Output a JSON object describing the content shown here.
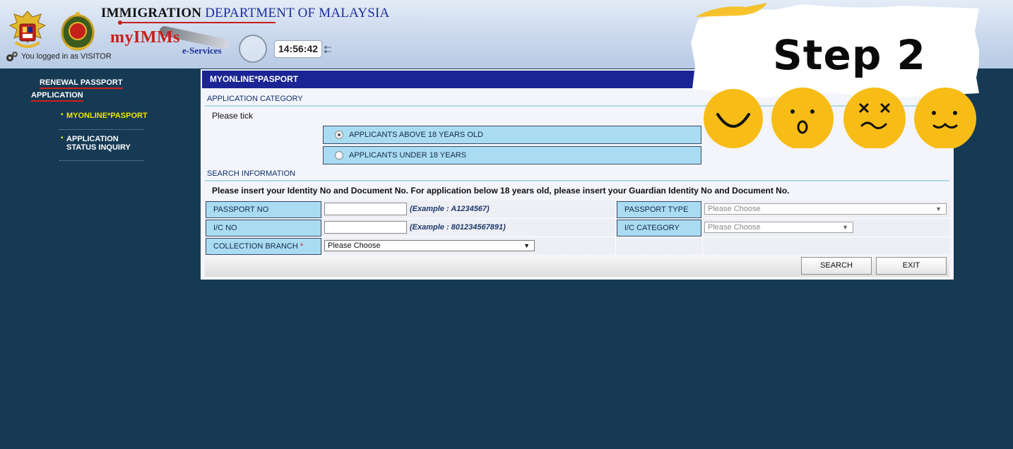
{
  "header": {
    "title_bold": "IMMIGRATION",
    "title_rest": "DEPARTMENT OF MALAYSIA",
    "app_name": "myIMMs",
    "app_sub": "e-Services",
    "clock": "14:56:42",
    "login_status": "You logged in as VISITOR"
  },
  "sidebar": {
    "heading_line1": "RENEWAL PASSPORT",
    "heading_line2": "APPLICATION",
    "items": [
      {
        "label": "MYONLINE*PASPORT"
      },
      {
        "label_line1": "APPLICATION",
        "label_line2": "STATUS INQUIRY"
      }
    ]
  },
  "main": {
    "panel_title": "MYONLINE*PASPORT",
    "application_category": {
      "heading": "APPLICATION CATEGORY",
      "instruction": "Please tick",
      "options": [
        {
          "label": "APPLICANTS ABOVE 18 YEARS OLD",
          "checked": true
        },
        {
          "label": "APPLICANTS UNDER 18 YEARS",
          "checked": false
        }
      ]
    },
    "search_information": {
      "heading": "SEARCH INFORMATION",
      "instruction": "Please insert your Identity No and Document No. For application below 18 years old, please insert your Guardian Identity No and Document No.",
      "passport_no": {
        "label": "PASSPORT NO",
        "value": "",
        "example": "(Example : A1234567)"
      },
      "ic_no": {
        "label": "I/C NO",
        "value": "",
        "example": "(Example : 801234567891)"
      },
      "collection_branch": {
        "label": "COLLECTION BRANCH",
        "required_mark": "*",
        "selected": "Please Choose"
      },
      "passport_type": {
        "label": "PASSPORT TYPE",
        "selected": "Please Choose"
      },
      "ic_category": {
        "label": "I/C CATEGORY",
        "selected": "Please Choose"
      }
    },
    "buttons": {
      "search": "SEARCH",
      "exit": "EXIT"
    }
  },
  "overlay": {
    "step_label": "Step 2"
  },
  "colors": {
    "background": "#163a54",
    "panel_header": "#1a2593",
    "label_cell": "#a9dcf3",
    "nav_active": "#f2e400",
    "brand_red": "#c4211a",
    "emoji_yellow": "#f7bd16"
  }
}
